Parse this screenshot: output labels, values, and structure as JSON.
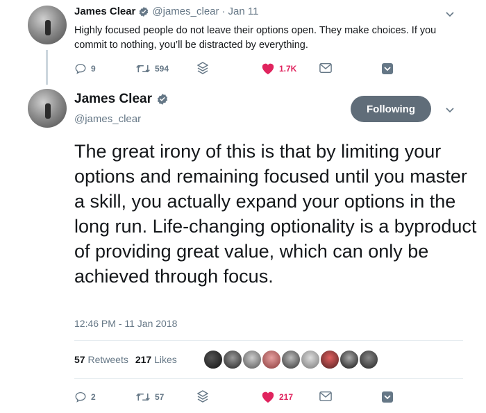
{
  "thread_tweet": {
    "name": "James Clear",
    "handle": "@james_clear",
    "separator": "·",
    "date": "Jan 11",
    "text": "Highly focused people do not leave their options open. They make choices. If you commit to nothing, you’ll be distracted by everything.",
    "replies": "9",
    "retweets": "594",
    "likes": "1.7K"
  },
  "main_tweet": {
    "name": "James Clear",
    "handle": "@james_clear",
    "follow_label": "Following",
    "text": "The great irony of this is that by limiting your options and remaining focused until you master a skill, you actually expand your options in the long run. Life-changing optionality is a byproduct of providing great value, which can only be achieved through focus.",
    "timestamp": "12:46 PM - 11 Jan 2018",
    "retweet_count": "57",
    "retweet_label": "Retweets",
    "like_count": "217",
    "like_label": "Likes",
    "replies": "2",
    "retweets": "57",
    "likes": "217"
  },
  "likers": [
    "avatar-1",
    "avatar-2",
    "avatar-3",
    "avatar-4",
    "avatar-5",
    "avatar-6",
    "avatar-7",
    "avatar-8",
    "avatar-9"
  ],
  "colors": {
    "verified": "#1da1f2",
    "like": "#e0245e",
    "muted": "#657786",
    "follow_button": "#606d79",
    "thread_line": "#ccd6dd"
  },
  "icons": {
    "reply": "reply-icon",
    "retweet": "retweet-icon",
    "stack": "stack-icon",
    "like": "heart-icon",
    "dm": "mail-icon",
    "bookmark": "bookmark-icon",
    "chevron": "chevron-down-icon",
    "verified": "verified-badge-icon"
  }
}
